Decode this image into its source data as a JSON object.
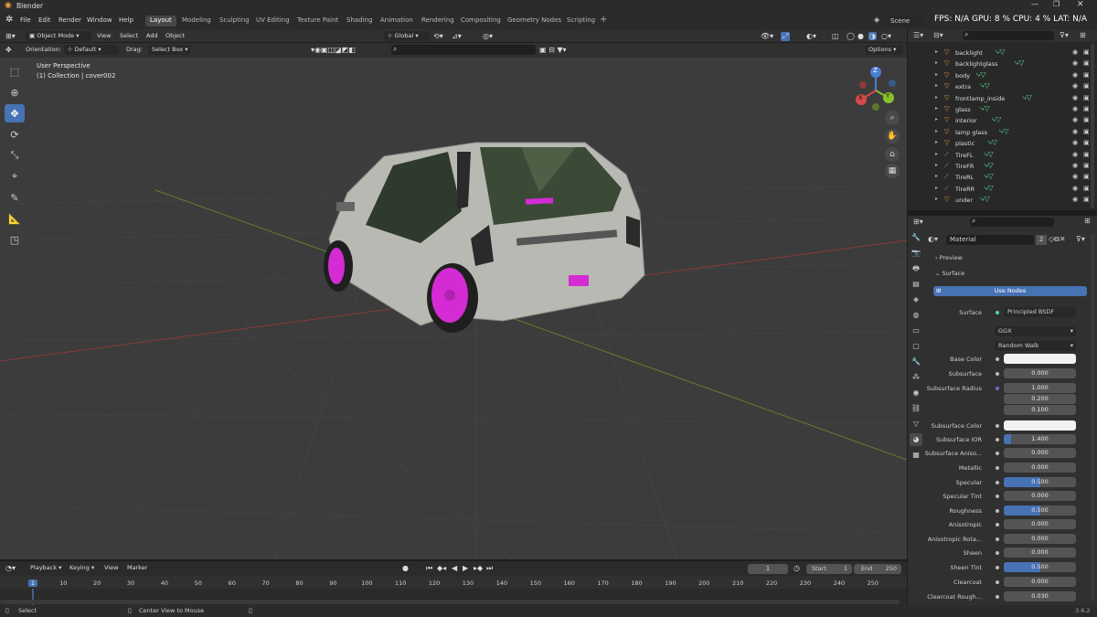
{
  "window": {
    "title": "Blender"
  },
  "menu": [
    "File",
    "Edit",
    "Render",
    "Window",
    "Help"
  ],
  "workspaces": [
    {
      "label": "Layout",
      "active": true
    },
    {
      "label": "Modeling"
    },
    {
      "label": "Sculpting"
    },
    {
      "label": "UV Editing"
    },
    {
      "label": "Texture Paint"
    },
    {
      "label": "Shading"
    },
    {
      "label": "Animation"
    },
    {
      "label": "Rendering"
    },
    {
      "label": "Compositing"
    },
    {
      "label": "Geometry Nodes"
    },
    {
      "label": "Scripting"
    }
  ],
  "topright": {
    "scene": "Scene",
    "stats": "FPS: N/A  GPU: 8 %  CPU: 4 %  LAT: N/A"
  },
  "viewport_header": {
    "mode": "Object Mode",
    "menus": [
      "View",
      "Select",
      "Add",
      "Object"
    ],
    "transform": "Global",
    "options": "Options"
  },
  "tool_settings": {
    "orientation_label": "Orientation:",
    "orientation_value": "Default",
    "drag_label": "Drag:",
    "drag_value": "Select Box"
  },
  "viewport": {
    "view_name": "User Perspective",
    "collection_info": "(1) Collection | cover002",
    "gizmo": {
      "z": "Z",
      "y": "Y",
      "x": "X"
    }
  },
  "outliner": {
    "items": [
      {
        "name": "backlight",
        "icon": "mesh-icon"
      },
      {
        "name": "backlightglass",
        "icon": "mesh-icon"
      },
      {
        "name": "body",
        "icon": "mesh-icon"
      },
      {
        "name": "extra",
        "icon": "mesh-icon"
      },
      {
        "name": "frontlamp_inside",
        "icon": "mesh-icon"
      },
      {
        "name": "glass",
        "icon": "mesh-icon"
      },
      {
        "name": "interior",
        "icon": "mesh-icon"
      },
      {
        "name": "lamp glass",
        "icon": "mesh-icon"
      },
      {
        "name": "plastic",
        "icon": "mesh-icon"
      },
      {
        "name": "TireFL",
        "icon": "armature-icon"
      },
      {
        "name": "TireFR",
        "icon": "armature-icon"
      },
      {
        "name": "TireRL",
        "icon": "armature-icon"
      },
      {
        "name": "TireRR",
        "icon": "armature-icon"
      },
      {
        "name": "under",
        "icon": "mesh-icon"
      }
    ]
  },
  "properties": {
    "material_name": "Material",
    "user_count": "2",
    "panels": {
      "preview": "Preview",
      "surface": "Surface"
    },
    "use_nodes": "Use Nodes",
    "surface_label": "Surface",
    "surface_shader": "Principled BSDF",
    "distribution": "GGX",
    "subsurface_method": "Random Walk",
    "params": [
      {
        "label": "Base Color",
        "type": "color",
        "value": ""
      },
      {
        "label": "Subsurface",
        "value": "0.000",
        "fill": 0
      },
      {
        "label": "Subsurface Radius",
        "value": "1.000",
        "fill": 0
      },
      {
        "label": "",
        "value": "0.200",
        "fill": 0
      },
      {
        "label": "",
        "value": "0.100",
        "fill": 0
      },
      {
        "label": "Subsurface Color",
        "type": "color",
        "value": ""
      },
      {
        "label": "Subsurface IOR",
        "value": "1.400",
        "fill": 0.1
      },
      {
        "label": "Subsurface Aniso...",
        "value": "0.000",
        "fill": 0
      },
      {
        "label": "Metallic",
        "value": "0.000",
        "fill": 0
      },
      {
        "label": "Specular",
        "value": "0.500",
        "fill": 0.5
      },
      {
        "label": "Specular Tint",
        "value": "0.000",
        "fill": 0
      },
      {
        "label": "Roughness",
        "value": "0.500",
        "fill": 0.5
      },
      {
        "label": "Anisotropic",
        "value": "0.000",
        "fill": 0
      },
      {
        "label": "Anisotropic Rota...",
        "value": "0.000",
        "fill": 0
      },
      {
        "label": "Sheen",
        "value": "0.000",
        "fill": 0
      },
      {
        "label": "Sheen Tint",
        "value": "0.500",
        "fill": 0.5
      },
      {
        "label": "Clearcoat",
        "value": "0.000",
        "fill": 0
      },
      {
        "label": "Clearcoat Rough...",
        "value": "0.030",
        "fill": 0
      }
    ]
  },
  "timeline": {
    "menus": [
      "Playback",
      "Keying",
      "View",
      "Marker"
    ],
    "current_frame": "1",
    "start_label": "Start",
    "start": "1",
    "end_label": "End",
    "end": "250",
    "ticks": [
      "1",
      "10",
      "20",
      "30",
      "40",
      "50",
      "60",
      "70",
      "80",
      "90",
      "100",
      "110",
      "120",
      "130",
      "140",
      "150",
      "160",
      "170",
      "180",
      "190",
      "200",
      "210",
      "220",
      "230",
      "240",
      "250"
    ]
  },
  "statusbar": {
    "left": "Select",
    "mid": "Center View to Mouse",
    "version": "3.6.2"
  },
  "colors": {
    "accent": "#4772b3",
    "rim": "#d42bd4",
    "orange": "#e39a4a",
    "green": "#5bd48f"
  }
}
